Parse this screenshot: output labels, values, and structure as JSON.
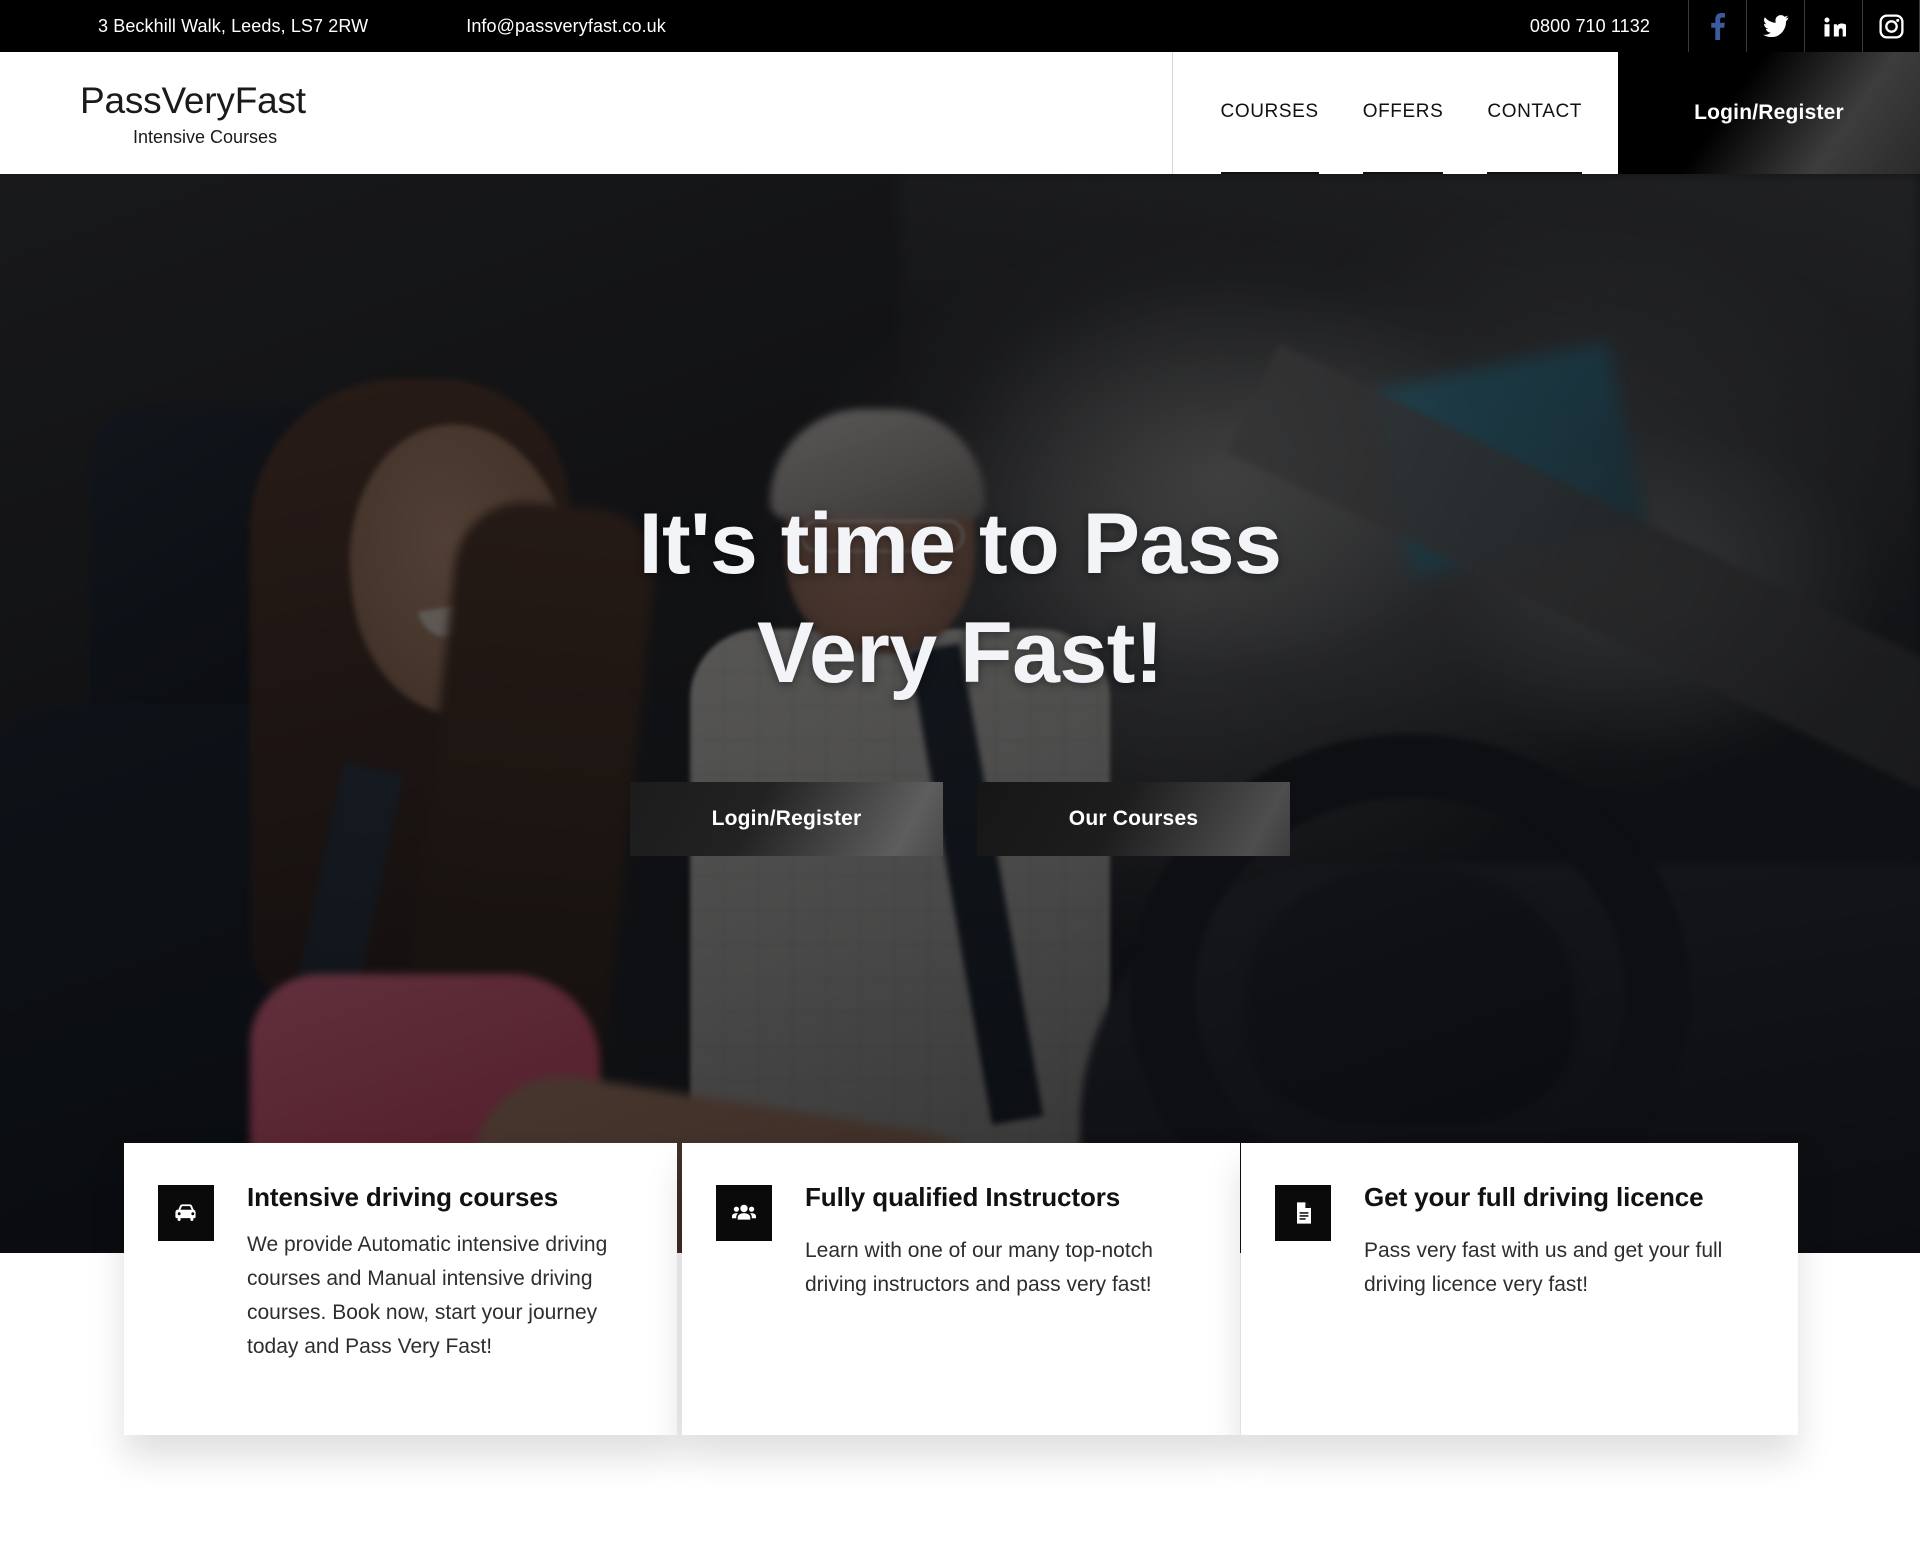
{
  "topbar": {
    "address": "3 Beckhill Walk, Leeds, LS7 2RW",
    "email": "Info@passveryfast.co.uk",
    "phone": "0800 710 1132",
    "social": [
      {
        "name": "facebook-icon",
        "label": "Facebook",
        "color": "#3a5ba0"
      },
      {
        "name": "twitter-icon",
        "label": "Twitter",
        "color": "#ffffff"
      },
      {
        "name": "linkedin-icon",
        "label": "LinkedIn",
        "color": "#ffffff"
      },
      {
        "name": "instagram-icon",
        "label": "Instagram",
        "color": "#ffffff"
      }
    ],
    "background": "#000000"
  },
  "header": {
    "brand_name": "PassVeryFast",
    "brand_sub": "Intensive Courses",
    "nav": [
      {
        "label": "COURSES"
      },
      {
        "label": "OFFERS"
      },
      {
        "label": "CONTACT"
      }
    ],
    "login_label": "Login/Register"
  },
  "hero": {
    "title_line1": "It's time to Pass",
    "title_line2": "Very Fast!",
    "primary_button": "Login/Register",
    "secondary_button": "Our Courses"
  },
  "features": [
    {
      "icon": "car-icon",
      "title": "Intensive driving courses",
      "text": "We provide Automatic intensive driving courses and Manual intensive driving courses. Book now, start your journey today and Pass Very Fast!"
    },
    {
      "icon": "users-icon",
      "title": "Fully qualified Instructors",
      "text": "Learn with one of our many top-notch driving instructors and pass very fast!"
    },
    {
      "icon": "document-icon",
      "title": "Get your full driving licence",
      "text": "Pass very fast with us and get your full driving licence very fast!"
    }
  ],
  "colors": {
    "black": "#000000",
    "white": "#ffffff",
    "facebook_blue": "#3a5ba0",
    "text_dark": "#111111"
  }
}
